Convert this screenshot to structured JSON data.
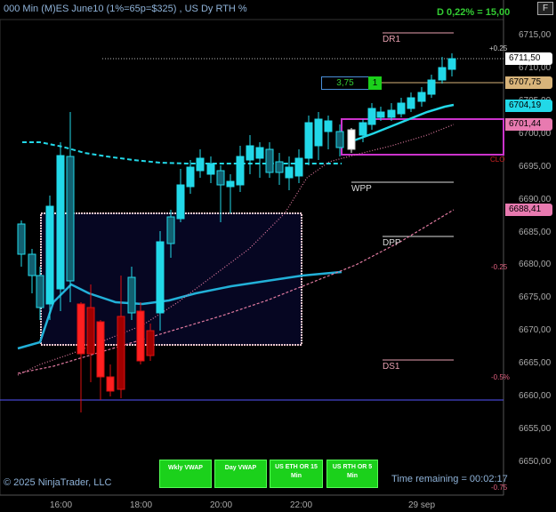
{
  "header": {
    "title": "000 Min (M)ES June10 (1%=65p=$325) , US Dy RTH %",
    "daily_stat": "D 0,22% = 15,00",
    "corner_button": "F"
  },
  "price_axis": {
    "ticks": [
      "6715,00",
      "6710,00",
      "6705,00",
      "6700,00",
      "6695,00",
      "6690,00",
      "6685,00",
      "6680,00",
      "6675,00",
      "6670,00",
      "6665,00",
      "6660,00",
      "6655,00",
      "6650,00"
    ]
  },
  "time_axis": {
    "ticks": [
      "16:00",
      "18:00",
      "20:00",
      "22:00",
      "29 sep"
    ]
  },
  "price_tags": [
    {
      "label": "6711,50",
      "color": "#ffffff"
    },
    {
      "label": "6707,75",
      "color": "#d8b47a"
    },
    {
      "label": "6704,19",
      "color": "#22d8e8"
    },
    {
      "label": "6701,44",
      "color": "#e87ab0"
    },
    {
      "label": "6688,41",
      "color": "#e87ab0"
    }
  ],
  "levels": [
    {
      "label": "DR1"
    },
    {
      "label": "WPP"
    },
    {
      "label": "DPP"
    },
    {
      "label": "DS1"
    }
  ],
  "pct_labels": [
    "+0.25",
    "CLO",
    "-0.25",
    "-0.5%",
    "-0.75"
  ],
  "profit": {
    "value": "3,75",
    "count": "1"
  },
  "buttons": [
    {
      "label": "Wkly VWAP"
    },
    {
      "label": "Day VWAP"
    },
    {
      "label": "US ETH OR 15 Min"
    },
    {
      "label": "US RTH OR 5 Min"
    }
  ],
  "footer": {
    "copyright": "© 2025 NinjaTrader, LLC",
    "time_remaining": "Time remaining = 00:02:17"
  },
  "colors": {
    "bull": "#22d8e8",
    "bear": "#ff2020",
    "vwap": "#22c0e0",
    "eth_or_border": "#f0c8d0",
    "rth_or_border": "#cc33cc"
  }
}
